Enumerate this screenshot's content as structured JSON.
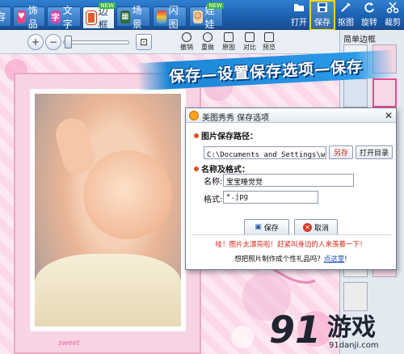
{
  "toolbar": {
    "tabs": [
      {
        "label": "容",
        "icon": "partial-tab-icon"
      },
      {
        "label": "饰品",
        "icon": "heart-icon"
      },
      {
        "label": "文字",
        "icon": "text-icon"
      },
      {
        "label": "边框",
        "icon": "frame-icon",
        "badge": "NEW",
        "active": true
      },
      {
        "label": "场景",
        "icon": "scene-icon"
      },
      {
        "label": "闪图",
        "icon": "flash-icon"
      },
      {
        "label": "娃娃",
        "icon": "doll-icon",
        "badge": "NEW"
      }
    ],
    "tools": [
      {
        "label": "打开",
        "icon": "open-icon"
      },
      {
        "label": "保存",
        "icon": "save-icon",
        "highlighted": true
      },
      {
        "label": "抠图",
        "icon": "cutout-icon"
      },
      {
        "label": "旋转",
        "icon": "rotate-icon"
      },
      {
        "label": "裁剪",
        "icon": "crop-icon"
      }
    ]
  },
  "edit_bar": {
    "zoom_in": "+",
    "zoom_out": "−",
    "undo": "撤销",
    "redo": "重做",
    "original": "原图",
    "compare": "对比",
    "preview": "预览"
  },
  "right_panel": {
    "title": "简单边框"
  },
  "banner": {
    "text": "保存—设置保存选项—保存"
  },
  "dialog": {
    "title": "美图秀秀 保存选项",
    "close": "✕",
    "path_section": "图片保存路径：",
    "path_value": "C:\\Documents and Settings\\wj\\桌",
    "browse_button": "另存",
    "open_dir_button": "打开目录",
    "name_section": "名称及格式：",
    "name_label": "名称:",
    "name_value": "宝宝睡觉觉",
    "format_label": "格式:",
    "format_value": "*.jpg",
    "save_button": "保存",
    "cancel_button": "取消",
    "tip": "哇！图片太漂亮啦！赶紧叫身边的人来羡慕一下！",
    "tip2_text": "想把照片制作成个性礼品吗？",
    "tip2_link": "点这里"
  },
  "canvas": {
    "frame_text": "sweet"
  },
  "watermark": {
    "logo": "91",
    "name": "游戏",
    "url": "91danji.com"
  },
  "colors": {
    "toolbar": "#1b5fae",
    "highlight": "#ffd700",
    "banner": "#1b86d6",
    "tip": "#d4281b"
  }
}
